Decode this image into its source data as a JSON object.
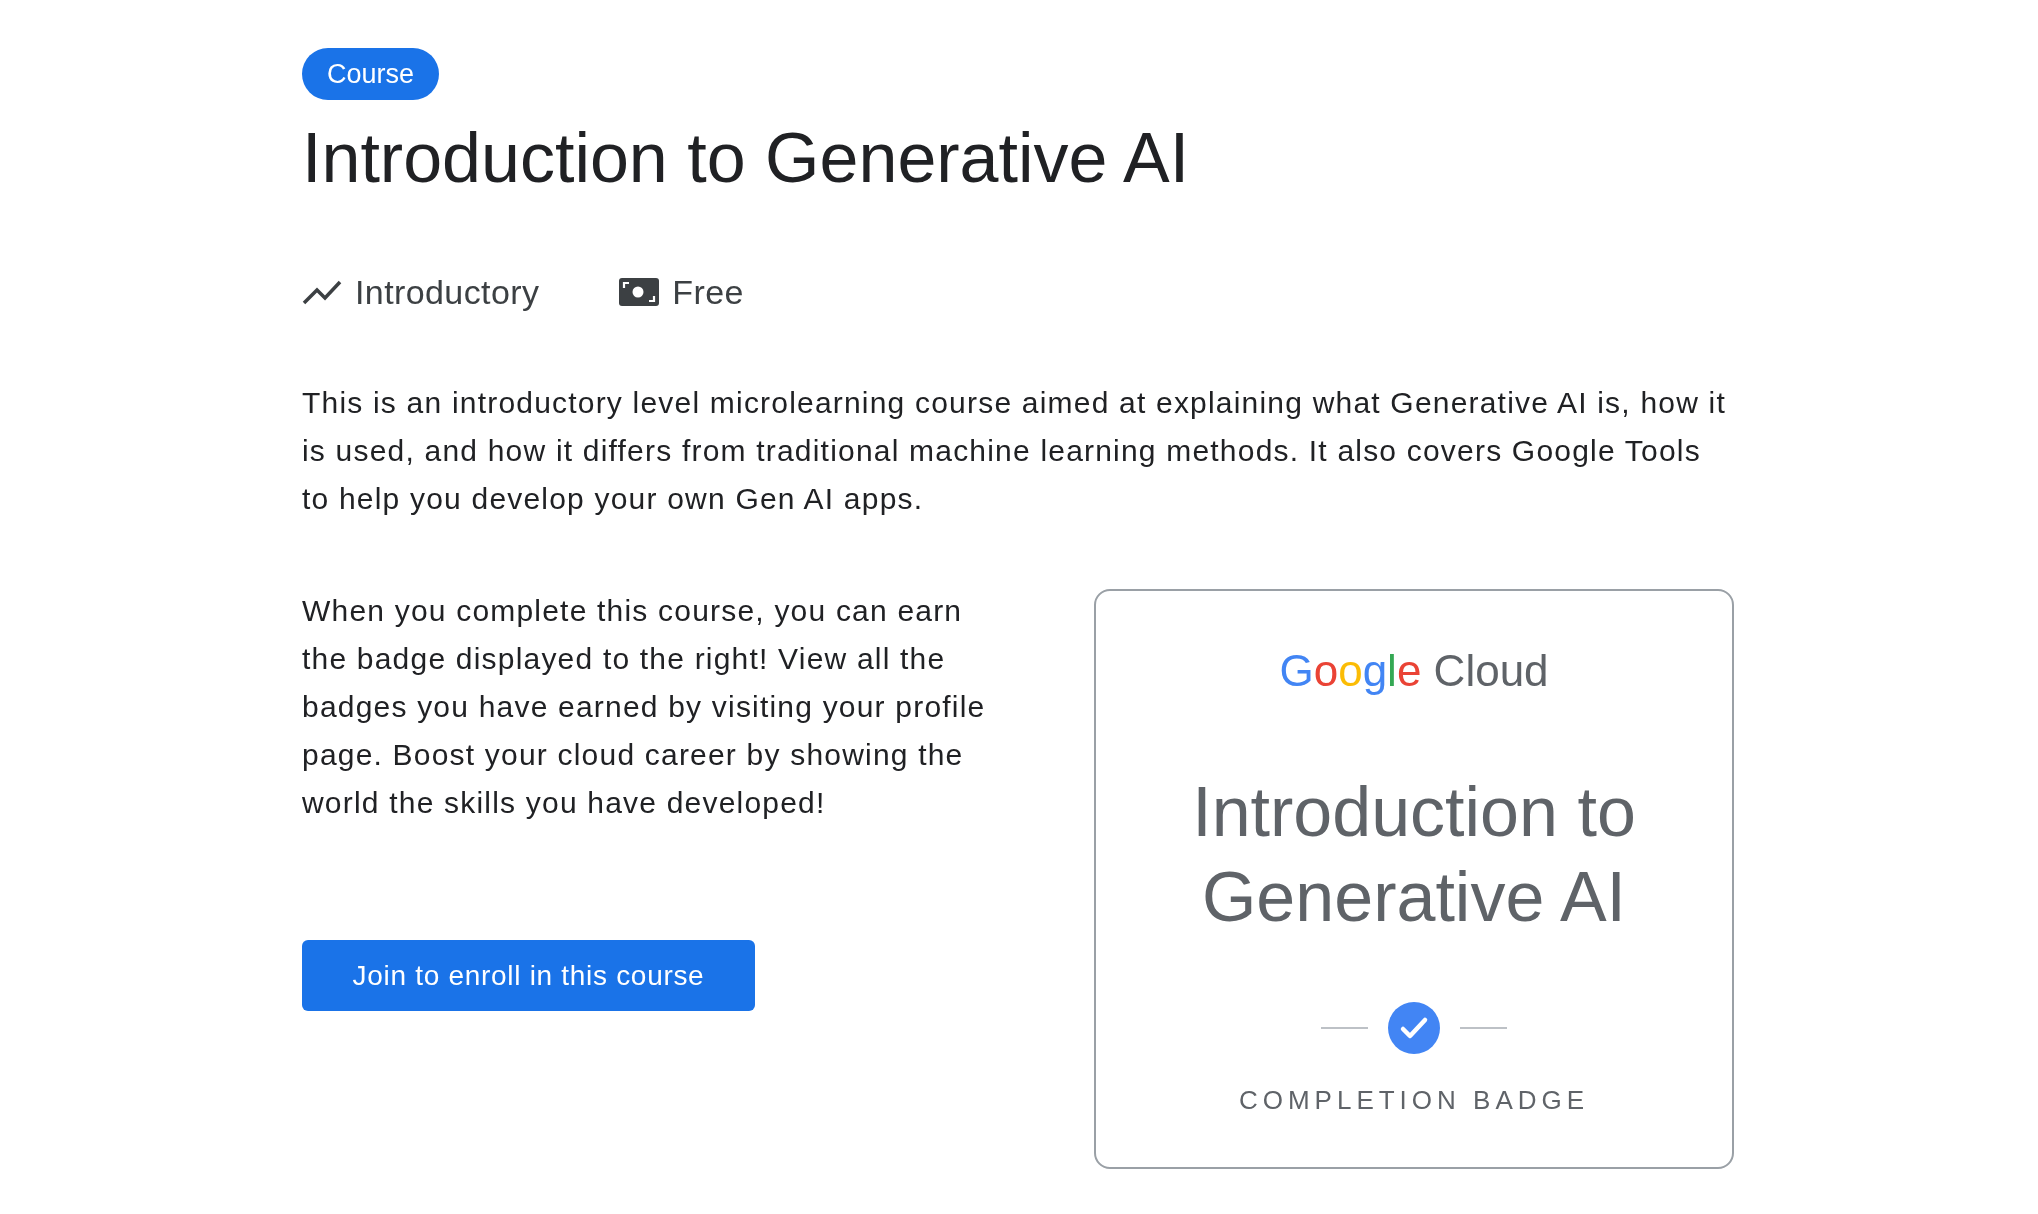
{
  "tag": "Course",
  "title": "Introduction to Generative AI",
  "meta": [
    {
      "kind": "level",
      "label": "Introductory"
    },
    {
      "kind": "price",
      "label": "Free"
    }
  ],
  "description": "This is an introductory level microlearning course aimed at explaining what Generative AI is, how it is used, and how it differs from traditional machine learning methods. It also covers Google Tools to help you develop your own Gen AI apps.",
  "badge_info": "When you complete this course, you can earn the badge displayed to the right! View all the badges you have earned by visiting your profile page. Boost your cloud career by showing the world the skills you have developed!",
  "enroll_button": "Join to enroll in this course",
  "badge": {
    "brand": "Google",
    "product": "Cloud",
    "title": "Introduction to Generative AI",
    "caption": "COMPLETION BADGE"
  }
}
